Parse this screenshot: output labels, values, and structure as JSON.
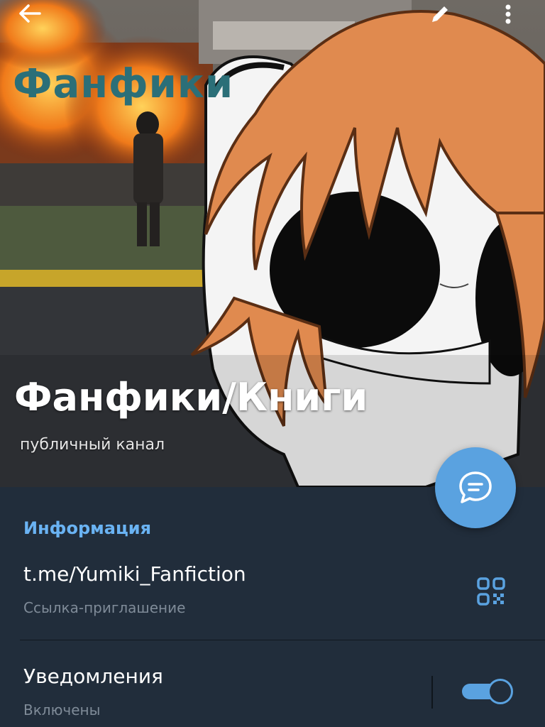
{
  "header": {
    "overlay_title": "Фанфики",
    "channel_name": "Фанфики/Книги",
    "channel_type": "публичный канал",
    "icons": {
      "back": "arrow-left-icon",
      "edit": "pencil-icon",
      "menu": "more-vertical-icon"
    }
  },
  "info": {
    "section_title": "Информация",
    "link": "t.me/Yumiki_Fanfiction",
    "link_caption": "Ссылка-приглашение",
    "qr_icon": "qr-code-icon"
  },
  "notifications": {
    "title": "Уведомления",
    "status": "Включены",
    "enabled": true
  },
  "fab_icon": "chat-bubble-icon",
  "colors": {
    "accent": "#5aa2e0",
    "link_blue": "#6ab3f3",
    "background": "#212d3b",
    "secondary_text": "#7f8b98"
  }
}
